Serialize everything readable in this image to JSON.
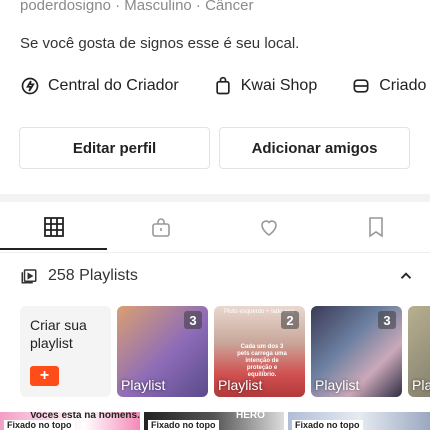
{
  "profile": {
    "meta": "poderdosigno · Masculino · Câncer",
    "bio": "Se você gosta de signos esse é seu local."
  },
  "links": [
    {
      "label": "Central do Criador",
      "icon": "lightning-circle-icon"
    },
    {
      "label": "Kwai Shop",
      "icon": "shopping-bag-icon"
    },
    {
      "label": "Criado",
      "icon": "creator-icon"
    }
  ],
  "buttons": {
    "edit_profile": "Editar perfil",
    "add_friends": "Adicionar amigos"
  },
  "tabs": [
    {
      "icon": "grid-icon",
      "active": true
    },
    {
      "icon": "lock-icon",
      "active": false
    },
    {
      "icon": "heart-icon",
      "active": false
    },
    {
      "icon": "bookmark-icon",
      "active": false
    }
  ],
  "playlists": {
    "count_label": "258 Playlists",
    "create_label": "Criar sua playlist",
    "create_plus": "+",
    "cards": [
      {
        "label": "Playlist",
        "count": "3"
      },
      {
        "label": "Playlist",
        "count": "2",
        "top_text": "Pluto esquerdo + lado esq",
        "overlay_text": "Cada um dos 3 pets carrega uma intenção de proteção e equilíbrio."
      },
      {
        "label": "Playlist",
        "count": "3"
      },
      {
        "label": "Pla"
      }
    ]
  },
  "pinned": {
    "label": "Fixado no topo",
    "items": [
      {
        "text": "Vocês está na homens."
      },
      {
        "text": "HERO"
      },
      {
        "text": ""
      }
    ]
  },
  "colors": {
    "accent": "#ff4d1a"
  }
}
